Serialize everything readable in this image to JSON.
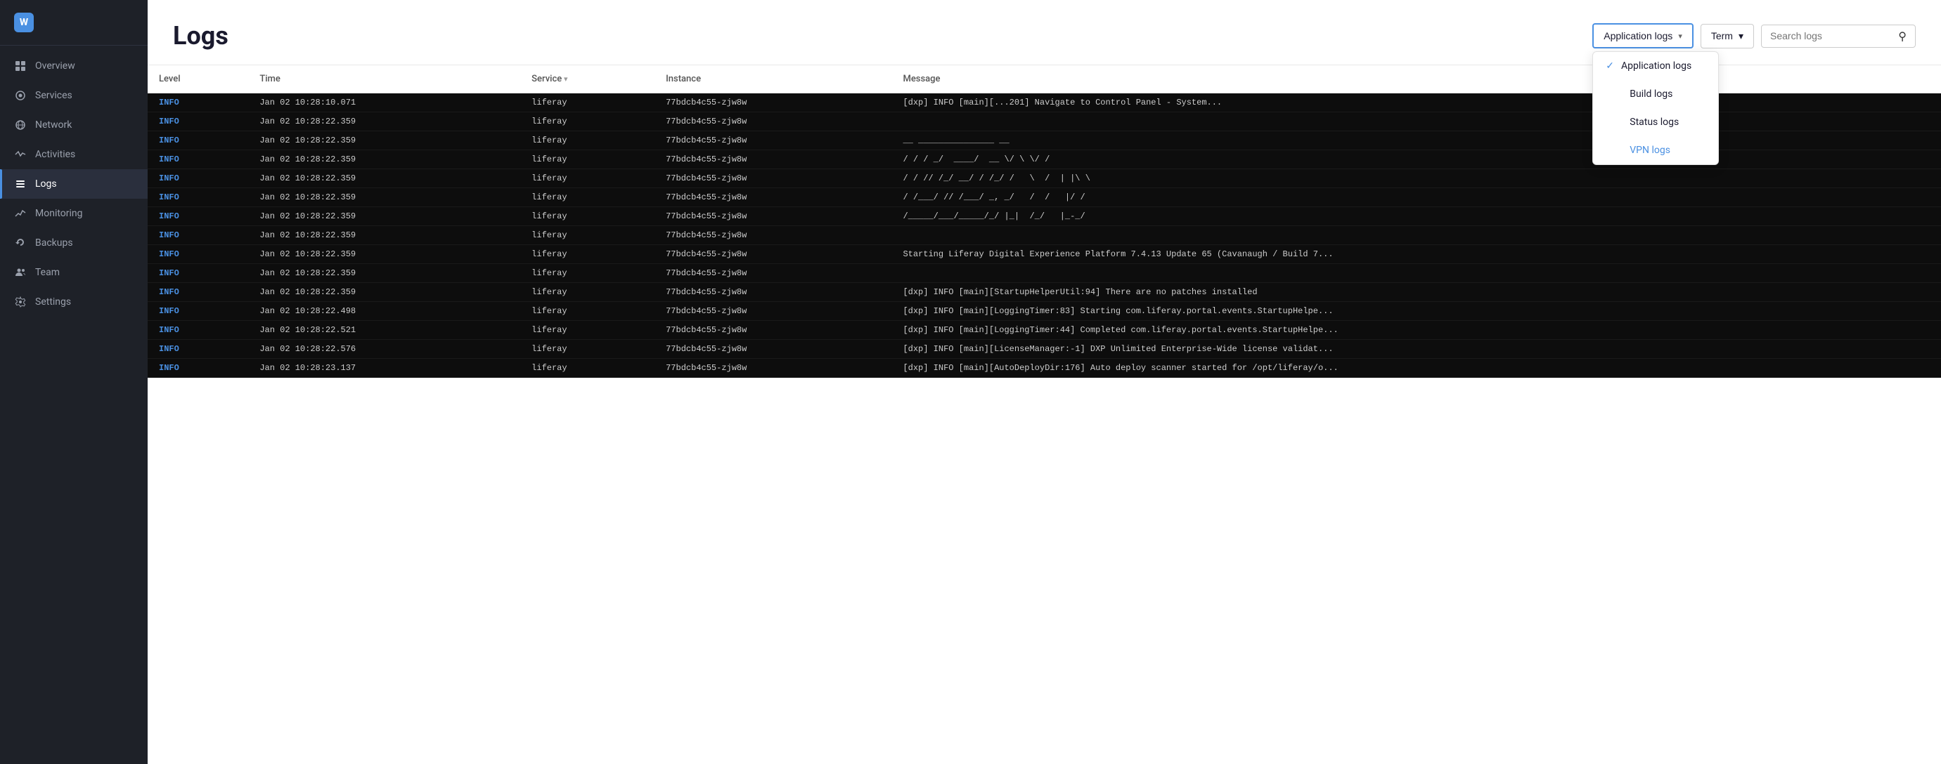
{
  "sidebar": {
    "items": [
      {
        "id": "overview",
        "label": "Overview",
        "icon": "⊞",
        "active": false
      },
      {
        "id": "services",
        "label": "Services",
        "icon": "◎",
        "active": false
      },
      {
        "id": "network",
        "label": "Network",
        "icon": "🌐",
        "icon_type": "globe",
        "active": false
      },
      {
        "id": "activities",
        "label": "Activities",
        "icon": "↺",
        "active": false
      },
      {
        "id": "logs",
        "label": "Logs",
        "icon": "≡",
        "active": true
      },
      {
        "id": "monitoring",
        "label": "Monitoring",
        "icon": "📈",
        "icon_type": "chart",
        "active": false
      },
      {
        "id": "backups",
        "label": "Backups",
        "icon": "💾",
        "icon_type": "backup",
        "active": false
      },
      {
        "id": "team",
        "label": "Team",
        "icon": "👥",
        "icon_type": "team",
        "active": false
      },
      {
        "id": "settings",
        "label": "Settings",
        "icon": "⚙",
        "active": false
      }
    ]
  },
  "page": {
    "title": "Logs"
  },
  "header": {
    "log_type_label": "Application logs",
    "log_type_chevron": "▾",
    "term_label": "Term",
    "term_chevron": "▾",
    "search_placeholder": "Search logs"
  },
  "dropdown": {
    "items": [
      {
        "id": "application-logs",
        "label": "Application logs",
        "selected": true
      },
      {
        "id": "build-logs",
        "label": "Build logs",
        "selected": false
      },
      {
        "id": "status-logs",
        "label": "Status logs",
        "selected": false
      },
      {
        "id": "vpn-logs",
        "label": "VPN logs",
        "selected": false,
        "special": true
      }
    ]
  },
  "table": {
    "columns": [
      {
        "id": "level",
        "label": "Level"
      },
      {
        "id": "time",
        "label": "Time"
      },
      {
        "id": "service",
        "label": "Service",
        "sortable": true
      },
      {
        "id": "instance",
        "label": "Instance"
      },
      {
        "id": "message",
        "label": "Message"
      }
    ],
    "rows": [
      {
        "level": "INFO",
        "time": "Jan 02 10:28:10.071",
        "service": "liferay",
        "instance": "77bdcb4c55-zjw8w",
        "message": "[dxp] INFO [main][...201] Navigate to Control Panel - System..."
      },
      {
        "level": "INFO",
        "time": "Jan 02 10:28:22.359",
        "service": "liferay",
        "instance": "77bdcb4c55-zjw8w",
        "message": ""
      },
      {
        "level": "INFO",
        "time": "Jan 02 10:28:22.359",
        "service": "liferay",
        "instance": "77bdcb4c55-zjw8w",
        "message": "__ _______________ __"
      },
      {
        "level": "INFO",
        "time": "Jan 02 10:28:22.359",
        "service": "liferay",
        "instance": "77bdcb4c55-zjw8w",
        "message": "/ / / _/  ____/  __ \\/ \\ \\/ /"
      },
      {
        "level": "INFO",
        "time": "Jan 02 10:28:22.359",
        "service": "liferay",
        "instance": "77bdcb4c55-zjw8w",
        "message": "/ / // /_/ __/ / /_/ /   \\  /  | |\\ \\"
      },
      {
        "level": "INFO",
        "time": "Jan 02 10:28:22.359",
        "service": "liferay",
        "instance": "77bdcb4c55-zjw8w",
        "message": "/ /___/ // /___/ _, _/   /  /   |/ /"
      },
      {
        "level": "INFO",
        "time": "Jan 02 10:28:22.359",
        "service": "liferay",
        "instance": "77bdcb4c55-zjw8w",
        "message": "/_____/___/_____/_/ |_|  /_/   |_-_/"
      },
      {
        "level": "INFO",
        "time": "Jan 02 10:28:22.359",
        "service": "liferay",
        "instance": "77bdcb4c55-zjw8w",
        "message": ""
      },
      {
        "level": "INFO",
        "time": "Jan 02 10:28:22.359",
        "service": "liferay",
        "instance": "77bdcb4c55-zjw8w",
        "message": "Starting Liferay Digital Experience Platform 7.4.13 Update 65 (Cavanaugh / Build 7..."
      },
      {
        "level": "INFO",
        "time": "Jan 02 10:28:22.359",
        "service": "liferay",
        "instance": "77bdcb4c55-zjw8w",
        "message": ""
      },
      {
        "level": "INFO",
        "time": "Jan 02 10:28:22.359",
        "service": "liferay",
        "instance": "77bdcb4c55-zjw8w",
        "message": "[dxp] INFO [main][StartupHelperUtil:94] There are no patches installed"
      },
      {
        "level": "INFO",
        "time": "Jan 02 10:28:22.498",
        "service": "liferay",
        "instance": "77bdcb4c55-zjw8w",
        "message": "[dxp] INFO [main][LoggingTimer:83] Starting com.liferay.portal.events.StartupHelpe..."
      },
      {
        "level": "INFO",
        "time": "Jan 02 10:28:22.521",
        "service": "liferay",
        "instance": "77bdcb4c55-zjw8w",
        "message": "[dxp] INFO [main][LoggingTimer:44] Completed com.liferay.portal.events.StartupHelpe..."
      },
      {
        "level": "INFO",
        "time": "Jan 02 10:28:22.576",
        "service": "liferay",
        "instance": "77bdcb4c55-zjw8w",
        "message": "[dxp] INFO [main][LicenseManager:-1] DXP Unlimited Enterprise-Wide license validat..."
      },
      {
        "level": "INFO",
        "time": "Jan 02 10:28:23.137",
        "service": "liferay",
        "instance": "77bdcb4c55-zjw8w",
        "message": "[dxp] INFO [main][AutoDeployDir:176] Auto deploy scanner started for /opt/liferay/o..."
      }
    ]
  },
  "colors": {
    "sidebar_bg": "#1e2128",
    "active_sidebar_item": "#2a2f3d",
    "accent_blue": "#4a90e2",
    "table_bg": "#0d0d0d",
    "info_color": "#4a90e2"
  }
}
